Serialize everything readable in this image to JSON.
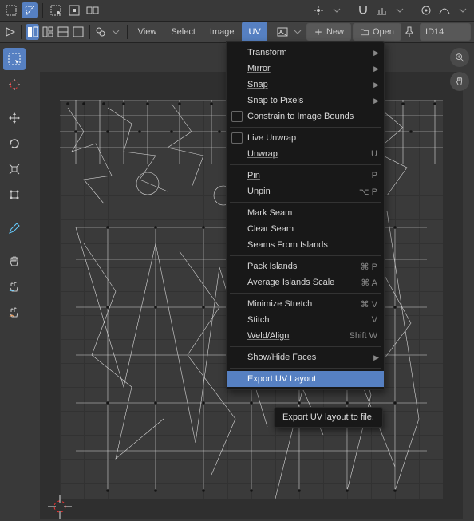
{
  "header1": {
    "select_modes": [
      "vertex",
      "edge",
      "face",
      "island"
    ]
  },
  "header2": {
    "menus": {
      "view": "View",
      "select": "Select",
      "image": "Image",
      "uv": "UV"
    },
    "new": "New",
    "open": "Open",
    "id": "ID14"
  },
  "dropdown": {
    "transform": "Transform",
    "mirror": "Mirror",
    "snap": "Snap",
    "snap_to_pixels": "Snap to Pixels",
    "constrain": "Constrain to Image Bounds",
    "live_unwrap": "Live Unwrap",
    "unwrap": "Unwrap",
    "unwrap_sc": "U",
    "pin": "Pin",
    "pin_sc": "P",
    "unpin": "Unpin",
    "unpin_sc": "⌥ P",
    "mark_seam": "Mark Seam",
    "clear_seam": "Clear Seam",
    "seams_islands": "Seams From Islands",
    "pack_islands": "Pack Islands",
    "pack_sc": "⌘ P",
    "avg_scale": "Average Islands Scale",
    "avg_scale_sc": "⌘ A",
    "min_stretch": "Minimize Stretch",
    "min_stretch_sc": "⌘ V",
    "stitch": "Stitch",
    "stitch_sc": "V",
    "weld": "Weld/Align",
    "weld_sc": "Shift W",
    "show_hide": "Show/Hide Faces",
    "export": "Export UV Layout"
  },
  "tooltip": "Export UV layout to file."
}
